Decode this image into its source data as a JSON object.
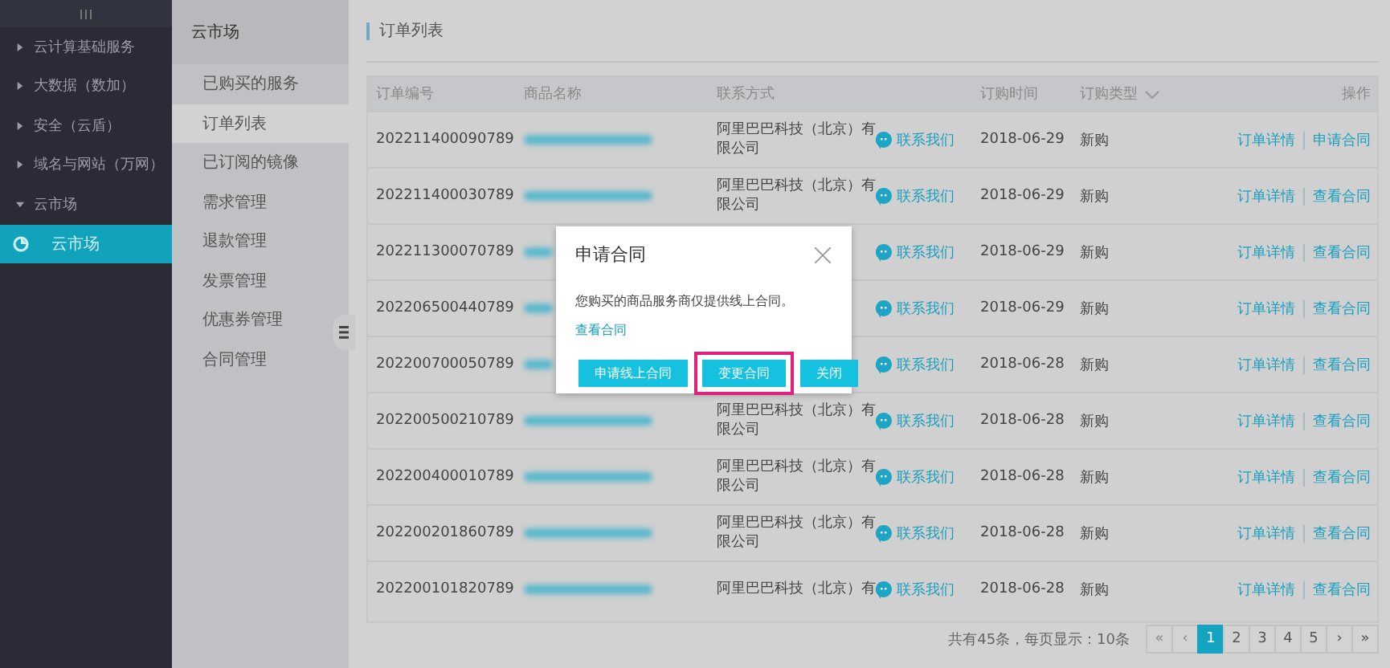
{
  "sidebar": {
    "items": [
      {
        "label": "云计算基础服务",
        "expanded": false
      },
      {
        "label": "大数据（数加）",
        "expanded": false
      },
      {
        "label": "安全（云盾）",
        "expanded": false
      },
      {
        "label": "域名与网站（万网）",
        "expanded": false
      },
      {
        "label": "云市场",
        "expanded": true,
        "children": [
          {
            "label": "云市场",
            "selected": true
          }
        ]
      }
    ]
  },
  "submenu": {
    "title": "云市场",
    "items": [
      {
        "label": "已购买的服务",
        "selected": false
      },
      {
        "label": "订单列表",
        "selected": true
      },
      {
        "label": "已订阅的镜像",
        "selected": false
      },
      {
        "label": "需求管理",
        "selected": false
      },
      {
        "label": "退款管理",
        "selected": false
      },
      {
        "label": "发票管理",
        "selected": false
      },
      {
        "label": "优惠券管理",
        "selected": false
      },
      {
        "label": "合同管理",
        "selected": false
      }
    ]
  },
  "page": {
    "title": "订单列表"
  },
  "table": {
    "columns": [
      "订单编号",
      "商品名称",
      "联系方式",
      "订购时间",
      "订购类型",
      "操作"
    ],
    "rows": [
      {
        "order_no": "202211400090789",
        "company": "阿里巴巴科技（北京）有限公司",
        "contact": "联系我们",
        "date": "2018-06-29",
        "type": "新购",
        "actions": [
          "订单详情",
          "申请合同"
        ]
      },
      {
        "order_no": "202211400030789",
        "company": "阿里巴巴科技（北京）有限公司",
        "contact": "联系我们",
        "date": "2018-06-29",
        "type": "新购",
        "actions": [
          "订单详情",
          "查看合同"
        ]
      },
      {
        "order_no": "202211300070789",
        "contact": "联系我们",
        "date": "2018-06-29",
        "type": "新购",
        "actions": [
          "订单详情",
          "查看合同"
        ]
      },
      {
        "order_no": "202206500440789",
        "contact": "联系我们",
        "date": "2018-06-29",
        "type": "新购",
        "actions": [
          "订单详情",
          "查看合同"
        ]
      },
      {
        "order_no": "202200700050789",
        "contact": "联系我们",
        "date": "2018-06-28",
        "type": "新购",
        "actions": [
          "订单详情",
          "查看合同"
        ]
      },
      {
        "order_no": "202200500210789",
        "company": "阿里巴巴科技（北京）有限公司",
        "contact": "联系我们",
        "date": "2018-06-28",
        "type": "新购",
        "actions": [
          "订单详情",
          "查看合同"
        ]
      },
      {
        "order_no": "202200400010789",
        "company": "阿里巴巴科技（北京）有限公司",
        "contact": "联系我们",
        "date": "2018-06-28",
        "type": "新购",
        "actions": [
          "订单详情",
          "查看合同"
        ]
      },
      {
        "order_no": "202200201860789",
        "company": "阿里巴巴科技（北京）有限公司",
        "contact": "联系我们",
        "date": "2018-06-28",
        "type": "新购",
        "actions": [
          "订单详情",
          "查看合同"
        ]
      },
      {
        "order_no": "202200101820789",
        "company": "阿里巴巴科技（北京）有",
        "contact": "联系我们",
        "date": "2018-06-28",
        "type": "新购",
        "actions": [
          "订单详情",
          "查看合同"
        ]
      }
    ]
  },
  "pagination": {
    "summary": "共有45条，每页显示：10条",
    "first": "«",
    "prev": "‹",
    "pages": [
      {
        "label": "1",
        "selected": true
      },
      {
        "label": "2",
        "selected": false
      },
      {
        "label": "3",
        "selected": false
      },
      {
        "label": "4",
        "selected": false
      },
      {
        "label": "5",
        "selected": false
      }
    ],
    "next": "›",
    "last": "»"
  },
  "dialog": {
    "title": "申请合同",
    "message": "您购买的商品服务商仅提供线上合同。",
    "link": "查看合同",
    "buttons": [
      {
        "label": "申请线上合同",
        "highlighted": false
      },
      {
        "label": "变更合同",
        "highlighted": true
      },
      {
        "label": "关闭",
        "highlighted": false
      }
    ]
  }
}
